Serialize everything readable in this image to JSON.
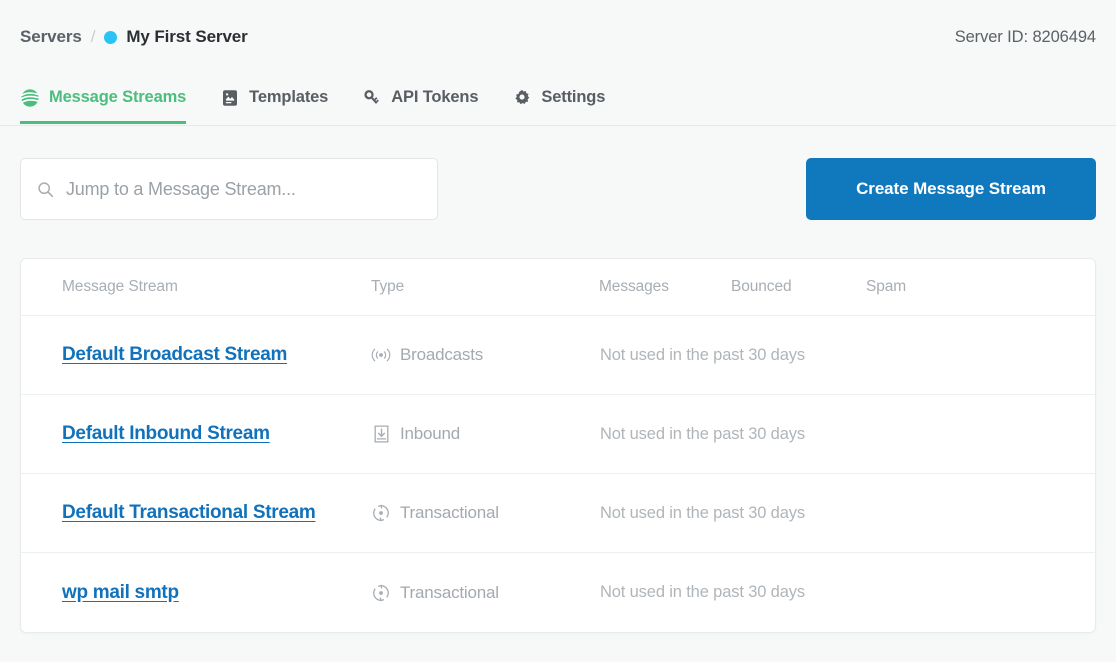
{
  "header": {
    "breadcrumb": {
      "root_label": "Servers",
      "separator": "/",
      "status_dot_color": "#29c4f4",
      "current_label": "My First Server"
    },
    "server_id_text": "Server ID: 8206494"
  },
  "tabs": [
    {
      "label": "Message Streams",
      "icon": "message-streams-icon",
      "active": true
    },
    {
      "label": "Templates",
      "icon": "templates-icon",
      "active": false
    },
    {
      "label": "API Tokens",
      "icon": "key-icon",
      "active": false
    },
    {
      "label": "Settings",
      "icon": "gear-icon",
      "active": false
    }
  ],
  "toolbar": {
    "search_placeholder": "Jump to a Message Stream...",
    "search_value": "",
    "search_icon": "search-icon",
    "create_button_label": "Create Message Stream",
    "create_button_color": "#1078bd"
  },
  "table": {
    "columns": [
      "Message Stream",
      "Type",
      "Messages",
      "Bounced",
      "Spam"
    ],
    "rows": [
      {
        "name": "Default Broadcast Stream",
        "type_icon": "broadcast-icon",
        "type": "Broadcasts",
        "usage": "Not used in the past 30 days",
        "messages": "",
        "bounced": "",
        "spam": ""
      },
      {
        "name": "Default Inbound Stream",
        "type_icon": "inbound-icon",
        "type": "Inbound",
        "usage": "Not used in the past 30 days",
        "messages": "",
        "bounced": "",
        "spam": ""
      },
      {
        "name": "Default Transactional Stream",
        "type_icon": "transactional-icon",
        "type": "Transactional",
        "usage": "Not used in the past 30 days",
        "messages": "",
        "bounced": "",
        "spam": ""
      },
      {
        "name": "wp mail smtp",
        "type_icon": "transactional-icon",
        "type": "Transactional",
        "usage": "Not used in the past 30 days",
        "messages": "",
        "bounced": "",
        "spam": ""
      }
    ]
  },
  "theme": {
    "accent_green": "#4cbd7f",
    "link_blue": "#1172bb",
    "page_background": "#f7f8f8"
  }
}
